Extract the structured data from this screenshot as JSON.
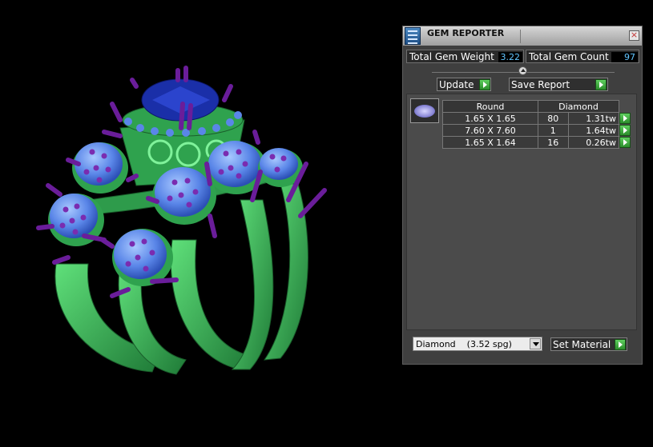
{
  "panel": {
    "title": "GEM REPORTER",
    "total_gem_weight_label": "Total Gem Weight",
    "total_gem_weight_value": "3.22",
    "total_gem_count_label": "Total Gem Count",
    "total_gem_count_value": "97",
    "update_label": "Update",
    "save_report_label": "Save Report",
    "table": {
      "header": [
        "Round",
        "Diamond"
      ],
      "rows": [
        {
          "size": "1.65 X 1.65",
          "count": "80",
          "weight": "1.31tw"
        },
        {
          "size": "7.60 X 7.60",
          "count": "1",
          "weight": "1.64tw"
        },
        {
          "size": "1.65 X 1.64",
          "count": "16",
          "weight": "0.26tw"
        }
      ]
    },
    "material_select": "Diamond    (3.52 spg)",
    "set_material_label": "Set Material"
  },
  "colors": {
    "ring_metal": "#3cb45a",
    "gem_blue": "#5a86e8",
    "prong_purple": "#6a1d9a",
    "center_stone": "#1a2fa8",
    "value_text": "#61c5ff"
  },
  "icons": {
    "title_icon": "gem-reporter-app-icon",
    "close": "close-icon",
    "go": "green-arrow-icon",
    "gem_shape": "round-gem-icon",
    "dropdown": "chevron-down-icon"
  }
}
